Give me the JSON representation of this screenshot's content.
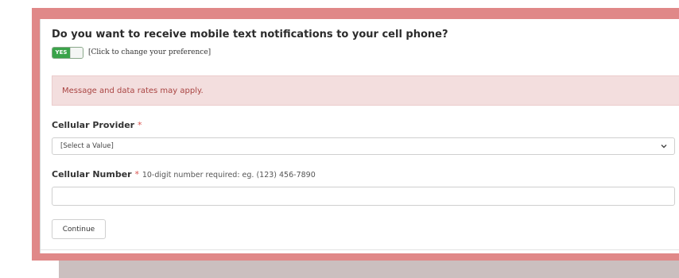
{
  "question": "Do you want to receive mobile text notifications to your cell phone?",
  "toggle": {
    "state_label": "YES",
    "hint": "[Click to change your preference]"
  },
  "alert": {
    "message": "Message and data rates may apply."
  },
  "provider": {
    "label": "Cellular Provider",
    "required_mark": "*",
    "selected_value": "[Select a Value]"
  },
  "number": {
    "label": "Cellular Number",
    "required_mark": "*",
    "hint": "10-digit number required: eg. (123) 456-7890",
    "value": ""
  },
  "continue_label": "Continue",
  "colors": {
    "frame": "#e08888",
    "toggle_on": "#3aa34a",
    "alert_bg": "#f3dede",
    "alert_text": "#a94442",
    "required": "#d9534f"
  }
}
